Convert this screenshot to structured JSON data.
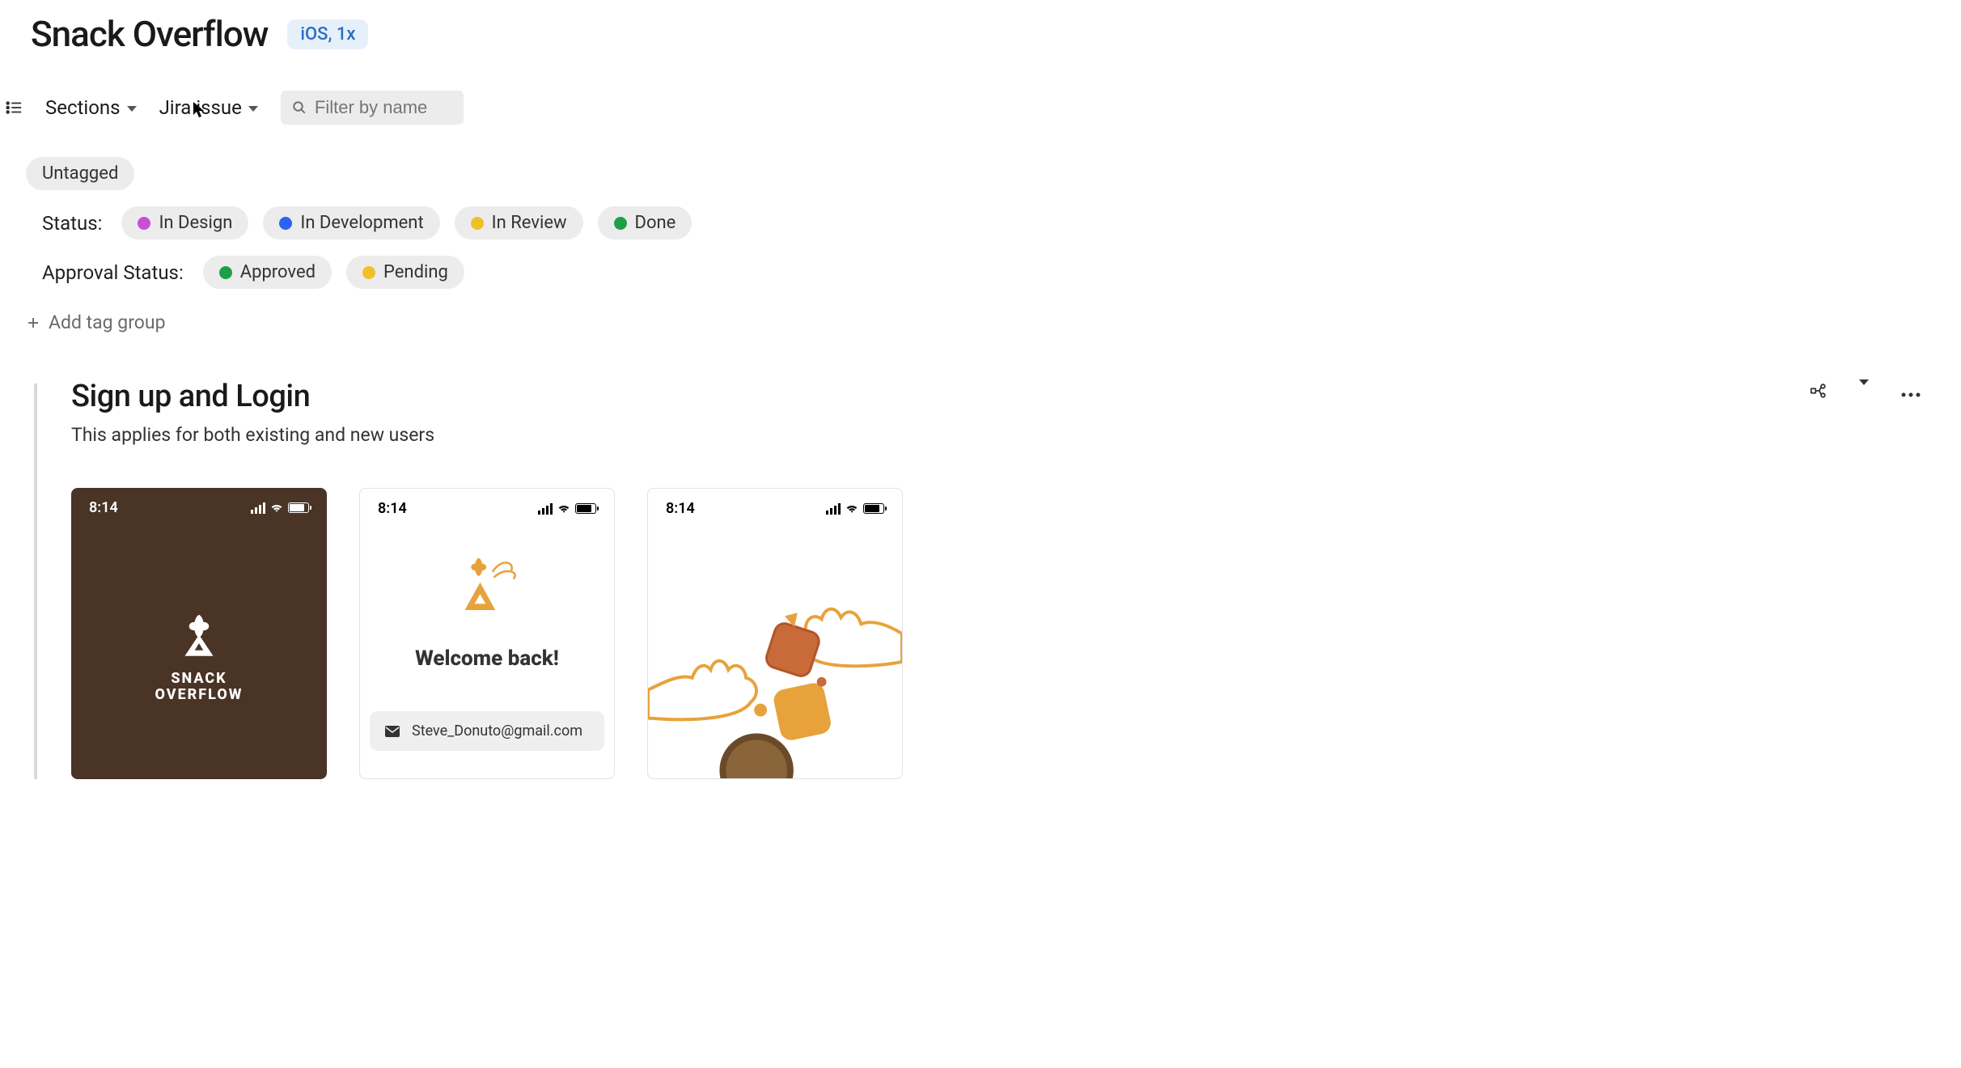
{
  "page": {
    "title": "Snack Overflow",
    "platform_badge": "iOS, 1x"
  },
  "toolbar": {
    "sections_label": "Sections",
    "jira_label": "Jira issue",
    "filter_placeholder": "Filter by name"
  },
  "tags": {
    "untagged_label": "Untagged",
    "status_label": "Status:",
    "status_items": [
      {
        "label": "In Design",
        "color": "#c94fd6"
      },
      {
        "label": "In Development",
        "color": "#2a63f0"
      },
      {
        "label": "In Review",
        "color": "#f0c02a"
      },
      {
        "label": "Done",
        "color": "#1f9e4a"
      }
    ],
    "approval_label": "Approval Status:",
    "approval_items": [
      {
        "label": "Approved",
        "color": "#1f9e4a"
      },
      {
        "label": "Pending",
        "color": "#f0c02a"
      }
    ],
    "add_group_label": "Add tag group"
  },
  "section": {
    "title": "Sign up and Login",
    "subtitle": "This applies for both existing and new users"
  },
  "screens": {
    "time": "8:14",
    "brand_line1": "SNACK",
    "brand_line2": "OVERFLOW",
    "welcome_back": "Welcome back!",
    "email": "Steve_Donuto@gmail.com"
  }
}
